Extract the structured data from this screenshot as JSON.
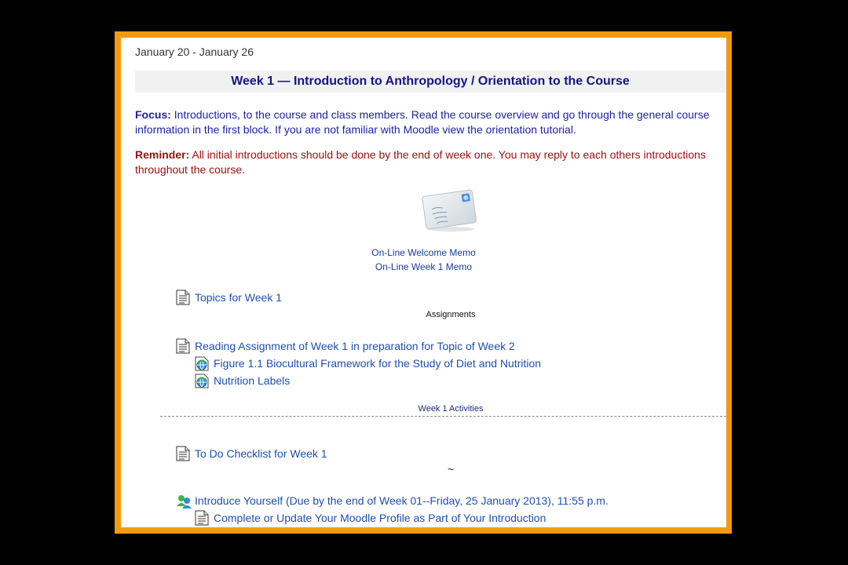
{
  "date_range": "January 20 - January 26",
  "week_title": "Week 1 — Introduction to Anthropology / Orientation to the Course",
  "focus": {
    "label": "Focus:",
    "text_1": "Introductions, to the course and class members. Read the course overview and go through the general course",
    "text_2": "information in the first block. If you are not familiar with Moodle view the",
    "link": "orientation tutorial",
    "text_3": "."
  },
  "reminder": {
    "label": "Reminder:",
    "text": "All initial introductions should be done by the end of week one. You may reply to each others introductions throughout the course."
  },
  "memos": [
    "On-Line Welcome Memo",
    "On-Line Week 1 Memo"
  ],
  "topics_link": "Topics for Week 1",
  "assignments_heading": "Assignments",
  "reading_link": "Reading Assignment of Week 1 in preparation for Topic of Week 2",
  "sub_links": [
    "Figure 1.1 Biocultural Framework for the Study of Diet and Nutrition",
    "Nutrition Labels"
  ],
  "activities_heading": "Week 1 Activities",
  "checklist_link": "To Do Checklist for Week 1",
  "tilde": "~",
  "introduce_link": "Introduce Yourself (Due by the end of Week 01--Friday, 25 January 2013), 11:55 p.m.",
  "profile_link": "Complete or Update Your Moodle Profile as Part of Your Introduction",
  "icons": {
    "page": "document-page-icon",
    "url": "web-link-globe-icon",
    "forum": "forum-people-icon",
    "memo": "envelope-icon"
  }
}
